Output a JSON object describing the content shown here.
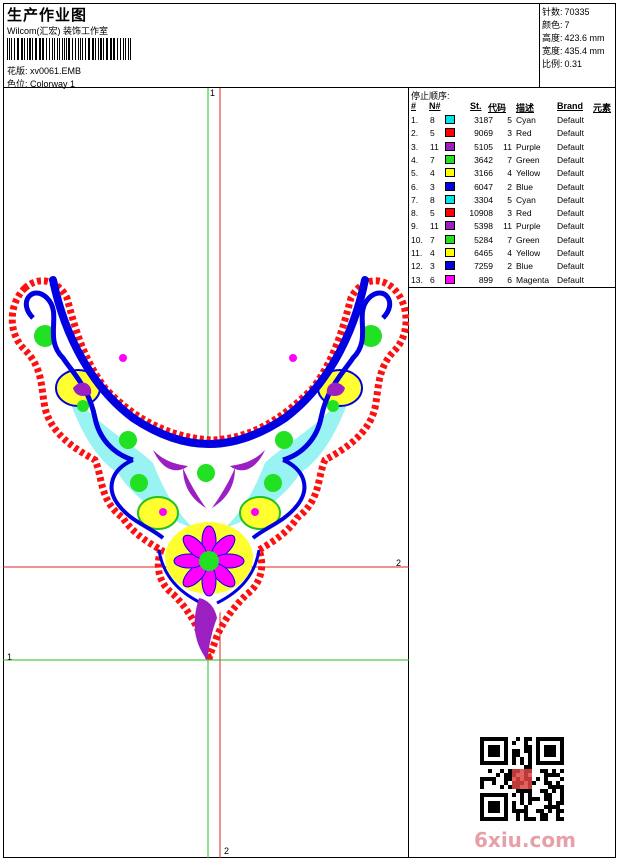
{
  "header": {
    "title": "生产作业图",
    "company": "Wilcom(汇宏) 装饰工作室",
    "design_label": "花版:",
    "design_value": "xv0061.EMB",
    "colorway_label": "色位:",
    "colorway_value": "Colorway 1"
  },
  "stats": {
    "stitches_label": "针数:",
    "stitches": "70335",
    "colors_label": "颜色:",
    "colors": "7",
    "height_label": "高度:",
    "height": "423.6 mm",
    "width_label": "宽度:",
    "width": "435.4 mm",
    "scale_label": "比例:",
    "scale": "0.31"
  },
  "sequence": {
    "heading": "停止顺序:",
    "columns": {
      "idx": "#",
      "n": "N#",
      "st": "St.",
      "code": "代码",
      "desc": "描述",
      "brand": "Brand",
      "elem": "元素"
    },
    "rows": [
      {
        "idx": "1.",
        "n": "8",
        "color": "#00e5e5",
        "st": "3187",
        "code": "5",
        "desc": "Cyan",
        "brand": "Default"
      },
      {
        "idx": "2.",
        "n": "5",
        "color": "#ff0000",
        "st": "9069",
        "code": "3",
        "desc": "Red",
        "brand": "Default"
      },
      {
        "idx": "3.",
        "n": "11",
        "color": "#9b1fc1",
        "st": "5105",
        "code": "11",
        "desc": "Purple",
        "brand": "Default"
      },
      {
        "idx": "4.",
        "n": "7",
        "color": "#22e022",
        "st": "3642",
        "code": "7",
        "desc": "Green",
        "brand": "Default"
      },
      {
        "idx": "5.",
        "n": "4",
        "color": "#ffff00",
        "st": "3166",
        "code": "4",
        "desc": "Yellow",
        "brand": "Default"
      },
      {
        "idx": "6.",
        "n": "3",
        "color": "#0000e0",
        "st": "6047",
        "code": "2",
        "desc": "Blue",
        "brand": "Default"
      },
      {
        "idx": "7.",
        "n": "8",
        "color": "#00e5e5",
        "st": "3304",
        "code": "5",
        "desc": "Cyan",
        "brand": "Default"
      },
      {
        "idx": "8.",
        "n": "5",
        "color": "#ff0000",
        "st": "10908",
        "code": "3",
        "desc": "Red",
        "brand": "Default"
      },
      {
        "idx": "9.",
        "n": "11",
        "color": "#9b1fc1",
        "st": "5398",
        "code": "11",
        "desc": "Purple",
        "brand": "Default"
      },
      {
        "idx": "10.",
        "n": "7",
        "color": "#22e022",
        "st": "5284",
        "code": "7",
        "desc": "Green",
        "brand": "Default"
      },
      {
        "idx": "11.",
        "n": "4",
        "color": "#ffff00",
        "st": "6465",
        "code": "4",
        "desc": "Yellow",
        "brand": "Default"
      },
      {
        "idx": "12.",
        "n": "3",
        "color": "#0000e0",
        "st": "7259",
        "code": "2",
        "desc": "Blue",
        "brand": "Default"
      },
      {
        "idx": "13.",
        "n": "6",
        "color": "#ff00ff",
        "st": "899",
        "code": "6",
        "desc": "Magenta",
        "brand": "Default"
      }
    ]
  },
  "canvas": {
    "guide_top": "1",
    "guide_right": "2",
    "guide_left": "1",
    "guide_bottom": "2"
  },
  "watermark": "6xiu.com"
}
